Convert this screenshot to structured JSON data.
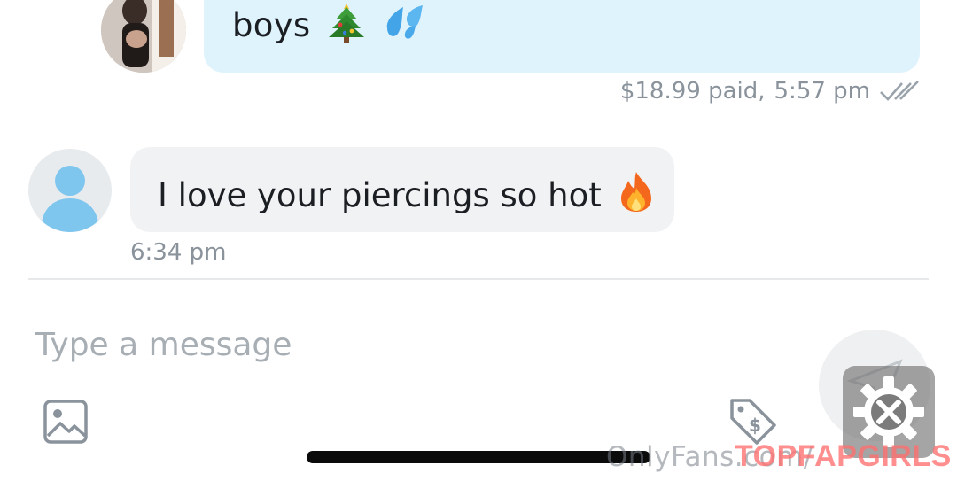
{
  "conversation": {
    "sent_message": {
      "text": "boys",
      "emojis": [
        "christmas-tree",
        "sweat-droplets"
      ],
      "price": "$18.99 paid,",
      "time": "5:57 pm",
      "status_icon": "double-check-icon"
    },
    "received_message": {
      "text": "I love your piercings so hot",
      "emoji": "fire",
      "time": "6:34 pm"
    }
  },
  "composer": {
    "placeholder": "Type a message",
    "buttons": [
      "image-icon",
      "price-tag-icon",
      "send-icon"
    ]
  },
  "watermark": {
    "url": "OnlyFans.com/",
    "brand": "TOPFAPGIRLS"
  },
  "colors": {
    "sent_bubble": "#dff3fd",
    "received_bubble": "#f1f2f3",
    "meta_text": "#8a939c",
    "icon_gray": "#8a939c",
    "avatar_blue": "#7fc6ef"
  }
}
